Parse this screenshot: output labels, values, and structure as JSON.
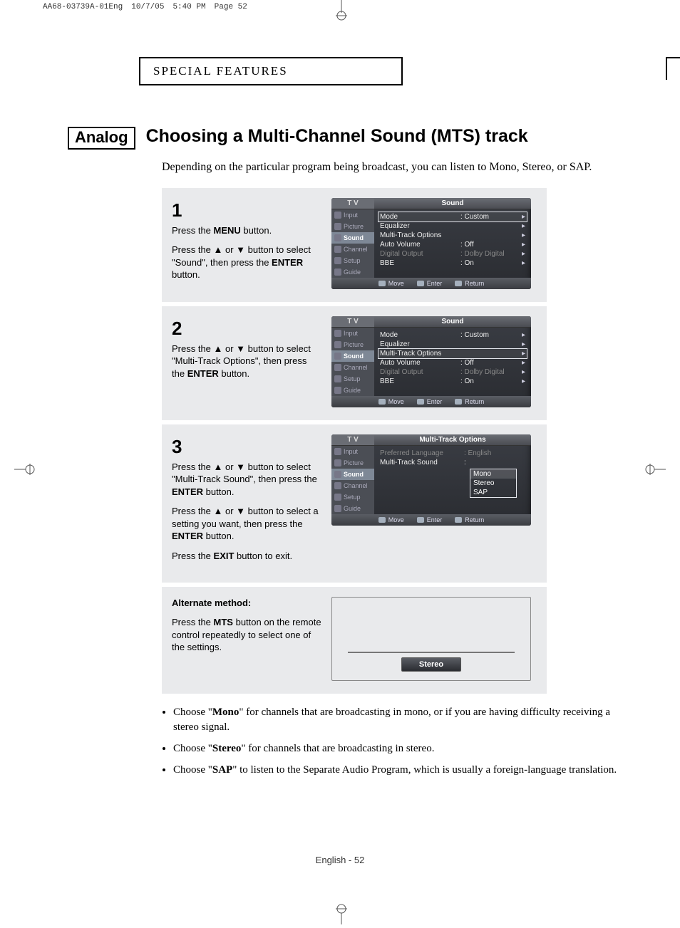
{
  "print_header": {
    "file": "AA68-03739A-01Eng",
    "date": "10/7/05",
    "time": "5:40 PM",
    "page": "Page 52"
  },
  "section_header": "SPECIAL FEATURES",
  "badge": "Analog",
  "title": "Choosing a Multi-Channel Sound (MTS) track",
  "intro": "Depending on the particular program being broadcast, you can listen to Mono, Stereo, or SAP.",
  "sidebar_items": [
    "Input",
    "Picture",
    "Sound",
    "Channel",
    "Setup",
    "Guide"
  ],
  "tv_brand": "T V",
  "tv_footer": {
    "move": "Move",
    "enter": "Enter",
    "return": "Return"
  },
  "step1": {
    "num": "1",
    "line1_pre": "Press the ",
    "line1_b": "MENU",
    "line1_post": " button.",
    "line2": "Press the ▲ or ▼ button to select \"Sound\", then press the ",
    "line2_b": "ENTER",
    "line2_post": " button.",
    "tv_title": "Sound",
    "rows": [
      {
        "label": "Mode",
        "value": ":  Custom",
        "sel": true
      },
      {
        "label": "Equalizer",
        "value": ""
      },
      {
        "label": "Multi-Track Options",
        "value": ""
      },
      {
        "label": "Auto Volume",
        "value": ":  Off"
      },
      {
        "label": "Digital Output",
        "value": ":  Dolby Digital",
        "dim": true
      },
      {
        "label": "BBE",
        "value": ":  On"
      }
    ]
  },
  "step2": {
    "num": "2",
    "text": "Press the ▲ or ▼ button to select \"Multi-Track Options\", then press the ",
    "text_b": "ENTER",
    "text_post": " button.",
    "tv_title": "Sound",
    "rows": [
      {
        "label": "Mode",
        "value": ":  Custom"
      },
      {
        "label": "Equalizer",
        "value": ""
      },
      {
        "label": "Multi-Track Options",
        "value": "",
        "sel": true
      },
      {
        "label": "Auto Volume",
        "value": ":  Off"
      },
      {
        "label": "Digital Output",
        "value": ":  Dolby Digital",
        "dim": true
      },
      {
        "label": "BBE",
        "value": ":  On"
      }
    ]
  },
  "step3": {
    "num": "3",
    "p1": "Press the ▲ or ▼ button to select \"Multi-Track Sound\", then press the ",
    "p1_b": "ENTER",
    "p1_post": " button.",
    "p2": "Press the ▲ or ▼ button to select a setting you want, then press the ",
    "p2_b": "ENTER",
    "p2_post": " button.",
    "p3_pre": "Press the ",
    "p3_b": "EXIT",
    "p3_post": " button to exit.",
    "tv_title": "Multi-Track Options",
    "row_lang_label": "Preferred Language",
    "row_lang_value": ":  English",
    "row_mts_label": "Multi-Track Sound",
    "row_mts_value": ":",
    "options": [
      "Mono",
      "Stereo",
      "SAP"
    ]
  },
  "alt": {
    "heading": "Alternate method:",
    "text_pre": "Press the ",
    "text_b": "MTS",
    "text_post": " button on the remote control repeatedly to select one of the settings.",
    "pill": "Stereo"
  },
  "notes": [
    {
      "pre": "Choose \"",
      "b": "Mono",
      "post": "\" for channels that are broadcasting in mono, or if you are having difficulty receiving a stereo signal."
    },
    {
      "pre": "Choose \"",
      "b": "Stereo",
      "post": "\" for channels that are broadcasting in stereo."
    },
    {
      "pre": "Choose \"",
      "b": "SAP",
      "post": "\" to listen to the Separate Audio Program, which is usually a foreign-language translation."
    }
  ],
  "footer": "English - 52",
  "chart_data": {
    "type": "table",
    "title": "TV Sound menu values shown in manual screenshots",
    "rows": [
      {
        "Setting": "Mode",
        "Value": "Custom"
      },
      {
        "Setting": "Equalizer",
        "Value": ""
      },
      {
        "Setting": "Multi-Track Options",
        "Value": ""
      },
      {
        "Setting": "Auto Volume",
        "Value": "Off"
      },
      {
        "Setting": "Digital Output",
        "Value": "Dolby Digital"
      },
      {
        "Setting": "BBE",
        "Value": "On"
      },
      {
        "Setting": "Preferred Language",
        "Value": "English"
      },
      {
        "Setting": "Multi-Track Sound options",
        "Value": "Mono / Stereo / SAP"
      }
    ]
  }
}
